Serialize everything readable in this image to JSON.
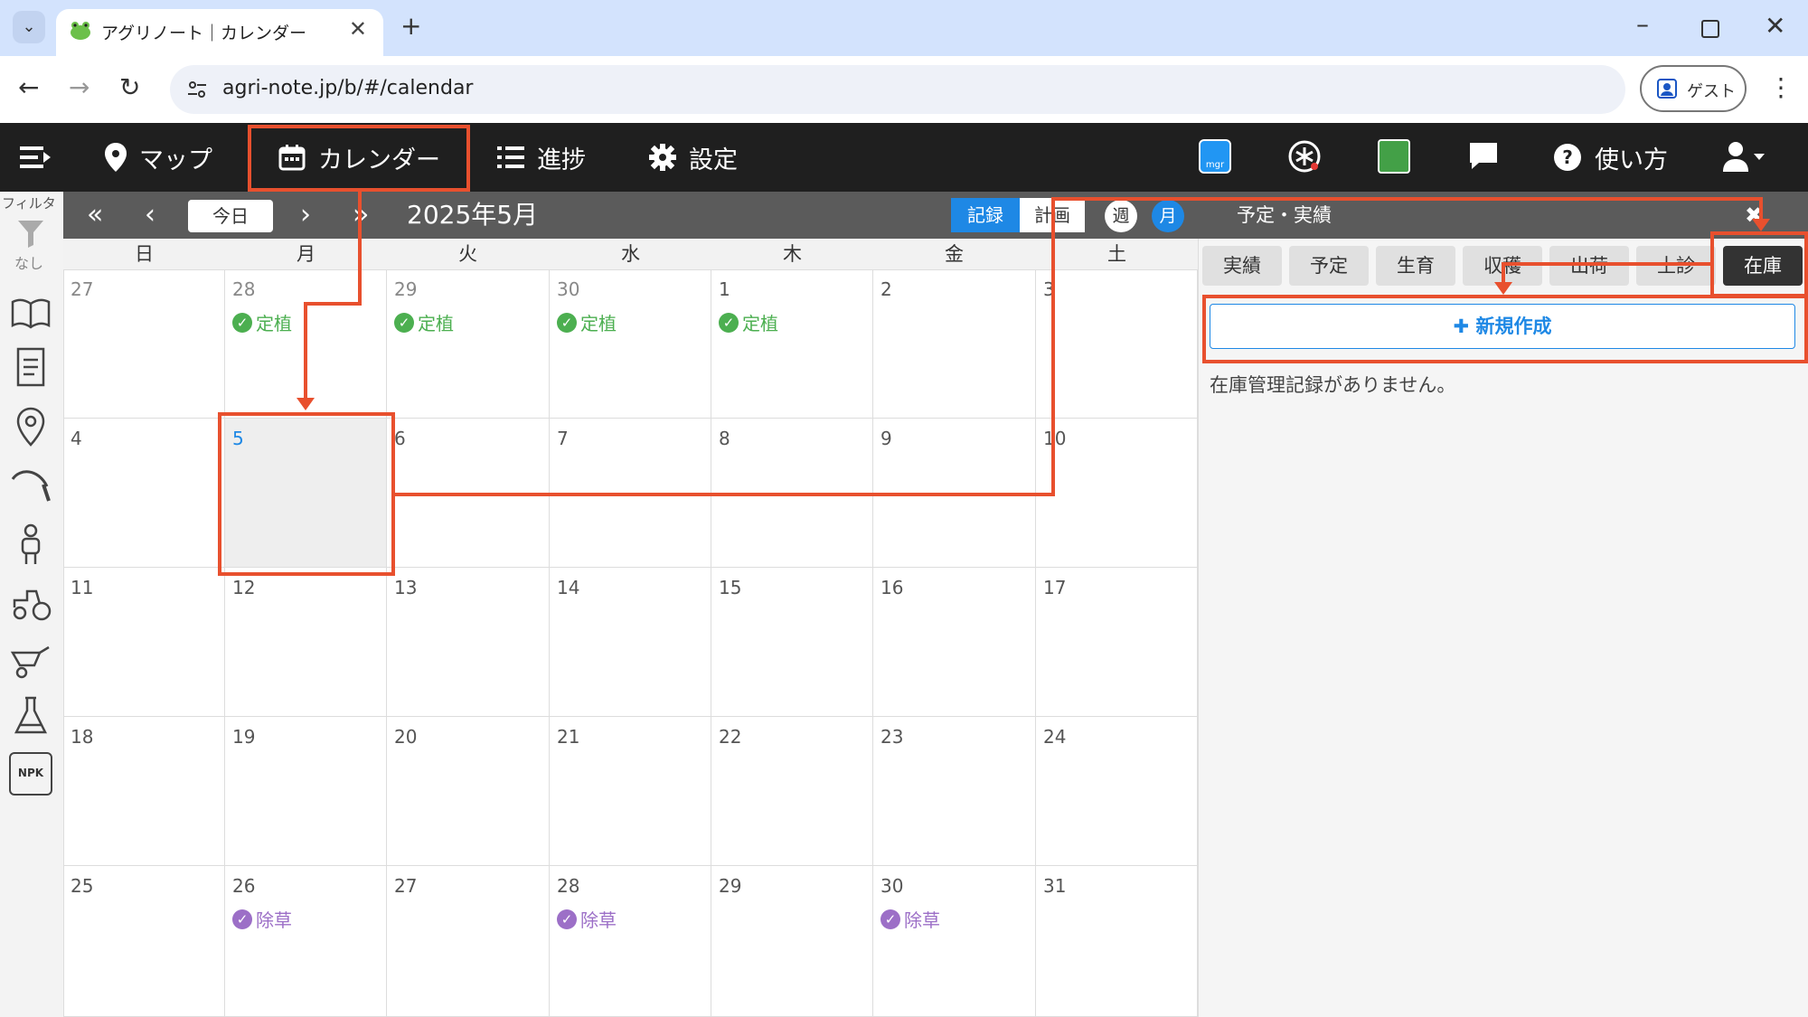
{
  "browser": {
    "tab_title": "アグリノート｜カレンダー",
    "url": "agri-note.jp/b/#/calendar",
    "guest_label": "ゲスト"
  },
  "nav": {
    "map": "マップ",
    "calendar": "カレンダー",
    "progress": "進捗",
    "settings": "設定",
    "help": "使い方"
  },
  "sidebar": {
    "filter": "フィルタ",
    "filter_state": "なし"
  },
  "calendar": {
    "today": "今日",
    "month_label": "2025年5月",
    "record": "記録",
    "plan": "計画",
    "week": "週",
    "month": "月",
    "weekdays": [
      "日",
      "月",
      "火",
      "水",
      "木",
      "金",
      "土"
    ],
    "weeks": [
      [
        "27",
        "28",
        "29",
        "30",
        "1",
        "2",
        "3"
      ],
      [
        "4",
        "5",
        "6",
        "7",
        "8",
        "9",
        "10"
      ],
      [
        "11",
        "12",
        "13",
        "14",
        "15",
        "16",
        "17"
      ],
      [
        "18",
        "19",
        "20",
        "21",
        "22",
        "23",
        "24"
      ],
      [
        "25",
        "26",
        "27",
        "28",
        "29",
        "30",
        "31"
      ]
    ],
    "events": {
      "planting": "定植",
      "weeding": "除草"
    }
  },
  "right_panel": {
    "title": "予定・実績",
    "tabs": [
      "実績",
      "予定",
      "生育",
      "収穫",
      "出荷",
      "土診",
      "在庫"
    ],
    "new_button": "新規作成",
    "empty_message": "在庫管理記録がありません。"
  },
  "colors": {
    "accent": "#1e88e5",
    "annotation": "#e8502e",
    "planting": "#4caf50",
    "weeding": "#9c6fc7"
  }
}
